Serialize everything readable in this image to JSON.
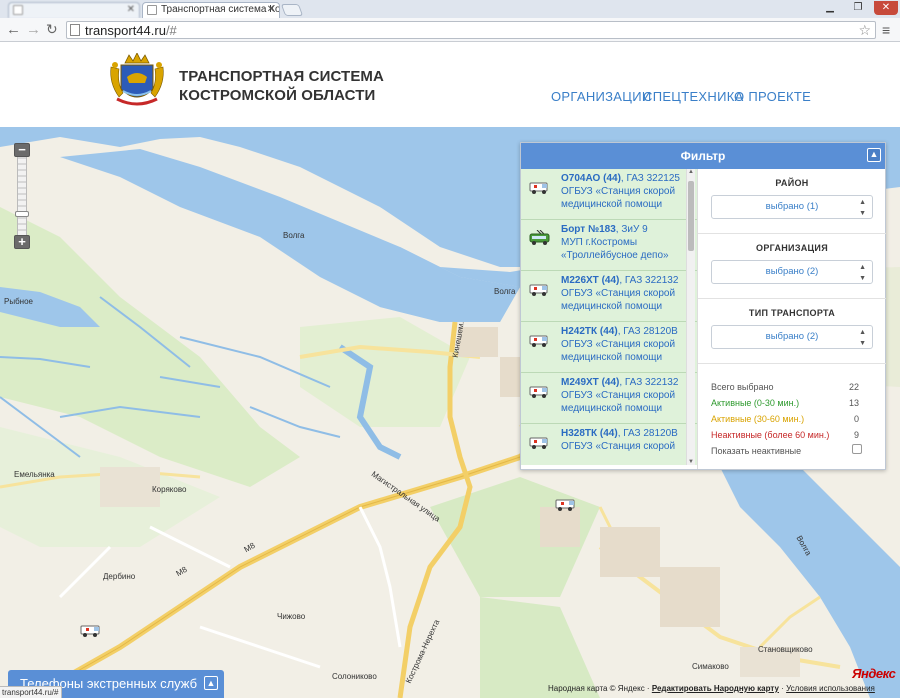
{
  "browser": {
    "tabs": [
      {
        "label": ""
      },
      {
        "label": "Транспортная система Кос"
      }
    ],
    "address": {
      "host": "transport44.ru",
      "path": "/#"
    },
    "status_url": "transport44.ru/#"
  },
  "header": {
    "title_line1": "ТРАНСПОРТНАЯ СИСТЕМА",
    "title_line2": "КОСТРОМСКОЙ ОБЛАСТИ",
    "nav": [
      "ОРГАНИЗАЦИИ",
      "СПЕЦТЕХНИКА",
      "О ПРОЕКТЕ"
    ]
  },
  "filter": {
    "title": "Фильтр",
    "vehicles": [
      {
        "plate": "О704АО (44)",
        "model": ", ГАЗ 322125",
        "org1": "ОГБУЗ «Станция скорой",
        "org2": "медицинской помощи",
        "icon": "ambulance-icon"
      },
      {
        "plate": "Борт №183",
        "model": ", ЗиУ 9",
        "org1": "МУП г.Костромы",
        "org2": "«Троллейбусное депо»",
        "icon": "trolleybus-icon"
      },
      {
        "plate": "М226ХТ (44)",
        "model": ", ГАЗ 322132",
        "org1": "ОГБУЗ «Станция скорой",
        "org2": "медицинской помощи",
        "icon": "ambulance-icon"
      },
      {
        "plate": "Н242ТК (44)",
        "model": ", ГАЗ 28120В",
        "org1": "ОГБУЗ «Станция скорой",
        "org2": "медицинской помощи",
        "icon": "ambulance-icon"
      },
      {
        "plate": "М249ХТ (44)",
        "model": ", ГАЗ 322132",
        "org1": "ОГБУЗ «Станция скорой",
        "org2": "медицинской помощи",
        "icon": "ambulance-icon"
      },
      {
        "plate": "Н328ТК (44)",
        "model": ", ГАЗ 28120В",
        "org1": "ОГБУЗ «Станция скорой",
        "org2": "",
        "icon": "ambulance-icon"
      }
    ],
    "groups": [
      {
        "title": "РАЙОН",
        "value": "выбрано (1)"
      },
      {
        "title": "ОРГАНИЗАЦИЯ",
        "value": "выбрано (2)"
      },
      {
        "title": "ТИП ТРАНСПОРТА",
        "value": "выбрано (2)"
      }
    ],
    "stats": [
      {
        "label": "Всего выбрано",
        "value": "22",
        "color": "#555555"
      },
      {
        "label": "Активные (0-30 мин.)",
        "value": "13",
        "color": "#2e9a2e"
      },
      {
        "label": "Активные (30-60 мин.)",
        "value": "0",
        "color": "#d9a300"
      },
      {
        "label": "Неактивные (более 60 мин.)",
        "value": "9",
        "color": "#c62828"
      }
    ],
    "show_inactive": "Показать неактивные"
  },
  "map": {
    "labels": {
      "volga1": "Волга",
      "volga2": "Волга",
      "volga3": "Волга",
      "rybnoe": "Рыбное",
      "emelyanka": "Емельянка",
      "koryakovo": "Коряково",
      "derbino": "Дербино",
      "chizhovo": "Чижово",
      "solonikovo": "Солониково",
      "simakovo": "Симаково",
      "stanovshchikovo": "Становщиково",
      "m8a": "М8",
      "m8b": "М8",
      "magistral": "Магистральная улица",
      "kostroma_nerekhta": "Кострома-Нерехта",
      "kineshem": "Кинешем."
    },
    "copyright_prefix": "Народная карта © Яндекс · ",
    "copyright_link": "Редактировать Народную карту",
    "copyright_terms": "Условия использования",
    "logo": "Яндекс"
  },
  "emergency": {
    "label": "Телефоны экстренных служб"
  },
  "colors": {
    "accent": "#5a8fd6",
    "link": "#3a7fc8",
    "active": "#dff2da",
    "water": "#9ec6ea"
  }
}
